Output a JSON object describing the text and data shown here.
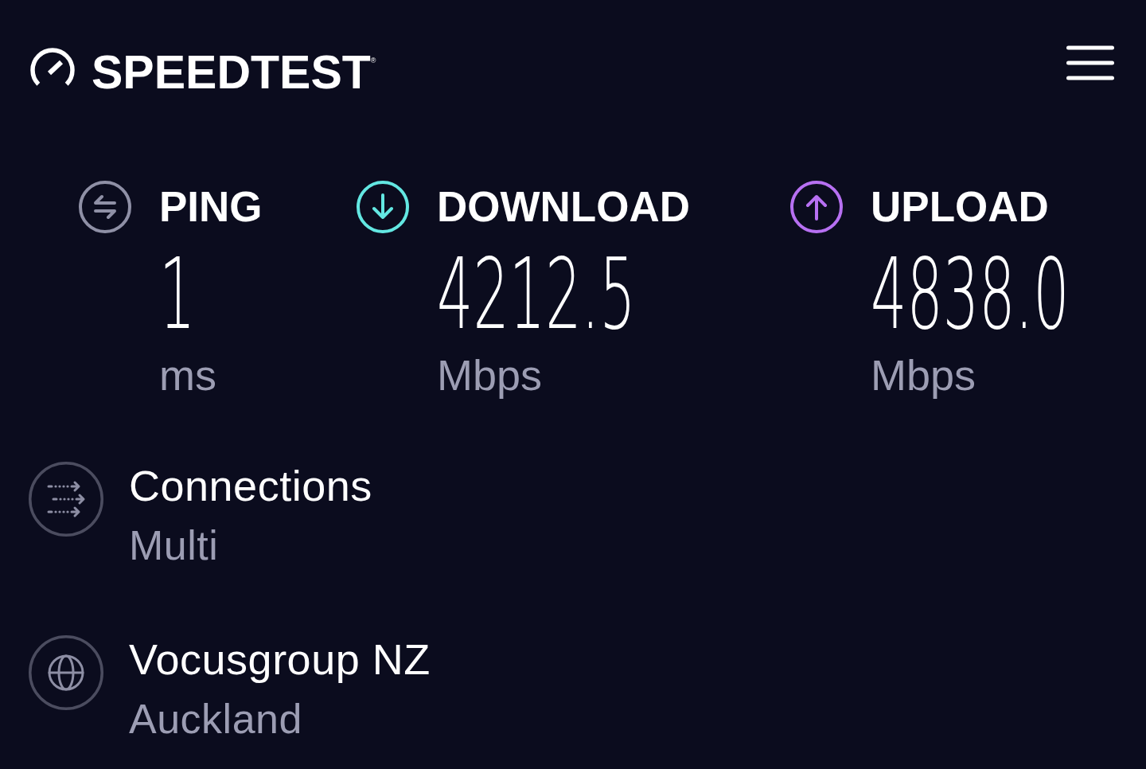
{
  "header": {
    "logo_text": "SPEEDTEST$^{®}$"
  },
  "metrics": [
    {
      "kind": "ping",
      "label": "PING",
      "value": "1",
      "unit": "ms",
      "color": "#8f90a6"
    },
    {
      "kind": "download",
      "label": "DOWNLOAD",
      "value": "4212.5",
      "unit": "Mbps",
      "color": "#63e7e2"
    },
    {
      "kind": "upload",
      "label": "UPLOAD",
      "value": "4838.0",
      "unit": "Mbps",
      "color": "#b770f2"
    }
  ],
  "details": [
    {
      "kind": "connections",
      "title": "Connections",
      "value": "Multi"
    },
    {
      "kind": "server",
      "title": "Vocusgroup NZ",
      "value": "Auckland"
    }
  ]
}
